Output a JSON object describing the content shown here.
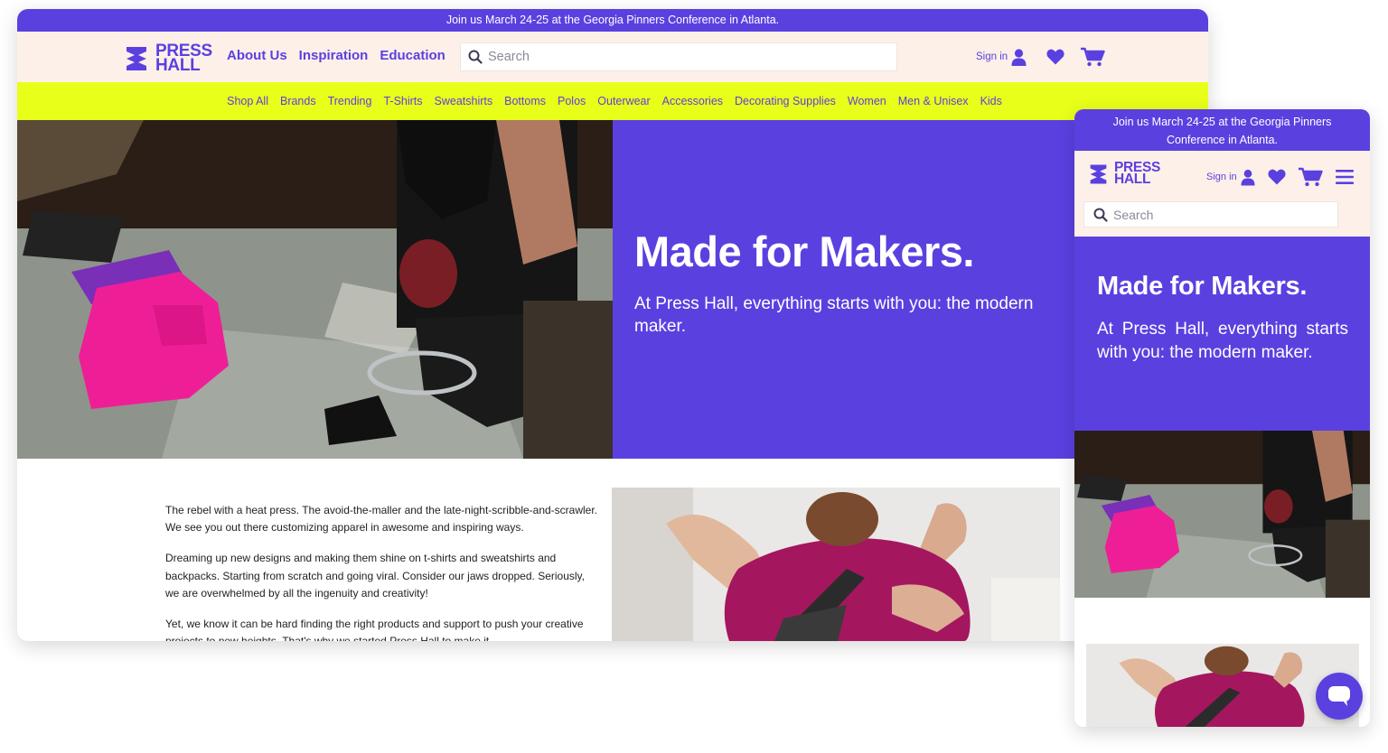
{
  "brand": {
    "logo_line1": "PRESS",
    "logo_line2": "HALL",
    "color_primary": "#5b40e0",
    "color_highlight": "#e8ff19",
    "color_cream": "#fdf0e8"
  },
  "announcement": {
    "desktop": "Join us March 24-25 at the Georgia Pinners Conference in Atlanta.",
    "mobile": "Join us March 24-25 at the Georgia Pinners Conference in Atlanta."
  },
  "topnav": [
    "About Us",
    "Inspiration",
    "Education"
  ],
  "search": {
    "placeholder": "Search"
  },
  "account": {
    "signin": "Sign in"
  },
  "icons": {
    "search": "search-icon",
    "user": "user-icon",
    "heart": "heart-icon",
    "cart": "cart-icon",
    "menu": "hamburger-menu-icon",
    "chat": "chat-icon"
  },
  "categories": [
    "Shop All",
    "Brands",
    "Trending",
    "T-Shirts",
    "Sweatshirts",
    "Bottoms",
    "Polos",
    "Outerwear",
    "Accessories",
    "Decorating Supplies",
    "Women",
    "Men & Unisex",
    "Kids"
  ],
  "hero": {
    "title": "Made for Makers.",
    "subtitle": "At Press Hall, everything starts with you: the modern maker."
  },
  "body": {
    "p1": "The rebel with a heat press. The avoid-the-maller and the late-night-scribble-and-scrawler. We see you out there customizing apparel in awesome and inspiring ways.",
    "p2": "Dreaming up new designs and making them shine on t-shirts and sweatshirts and backpacks. Starting from scratch and going viral. Consider our jaws dropped. Seriously, we are overwhelmed by all the ingenuity and creativity!",
    "p3": "Yet, we know it can be hard finding the right products and support to push your creative projects to new heights. That's why we started Press Hall to make it"
  }
}
